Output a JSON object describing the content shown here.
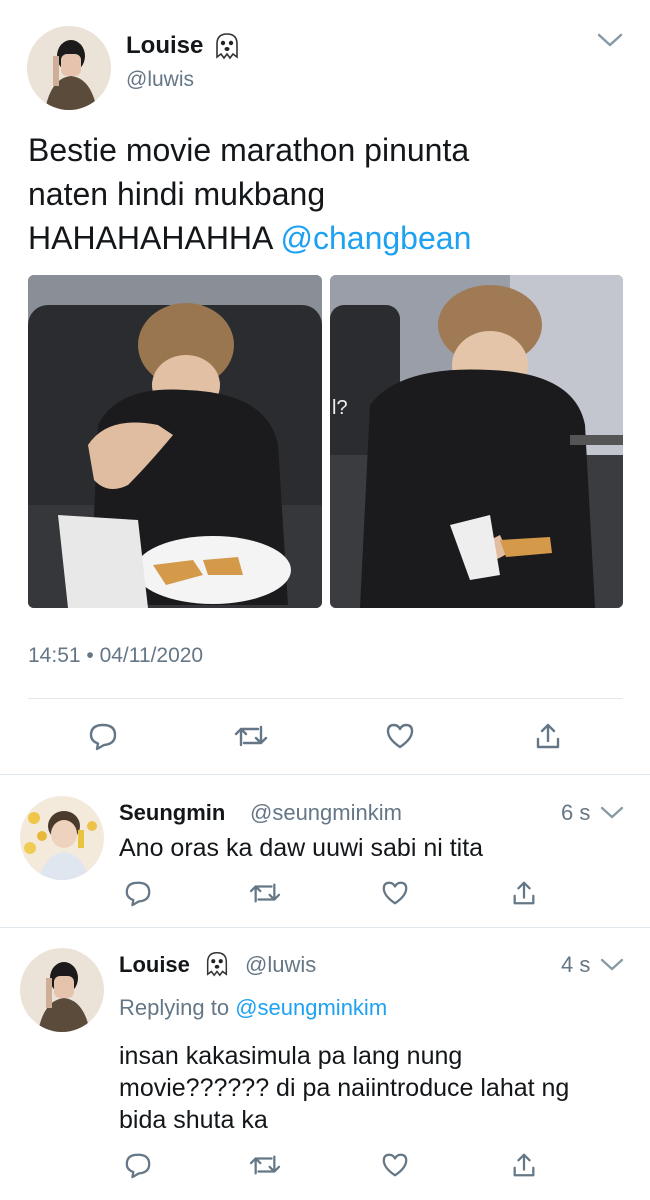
{
  "tweet": {
    "author": {
      "name": "Louise",
      "handle": "@luwis",
      "emoji": "ghost-icon"
    },
    "text_line1": "Bestie movie marathon pinunta",
    "text_line2": "naten hindi mukbang",
    "text_line3_plain": "HAHAHAHAHHA",
    "mention": "@changbean",
    "photo_right_caption": "l?",
    "timestamp": "14:51 • 04/11/2020"
  },
  "replies": [
    {
      "name": "Seungmin",
      "handle": "@seungminkim",
      "time": "6 s",
      "text": "Ano oras ka daw uuwi sabi ni tita"
    },
    {
      "name": "Louise",
      "handle": "@luwis",
      "time": "4 s",
      "replying_label": "Replying to",
      "replying_to": "@seungminkim",
      "text_line1": "insan kakasimula pa lang nung",
      "text_line2": "movie?????? di pa naiintroduce lahat ng",
      "text_line3": "bida shuta ka"
    }
  ],
  "colors": {
    "accent": "#1da1f2",
    "muted": "#657786",
    "divider": "#e1e8ed"
  }
}
